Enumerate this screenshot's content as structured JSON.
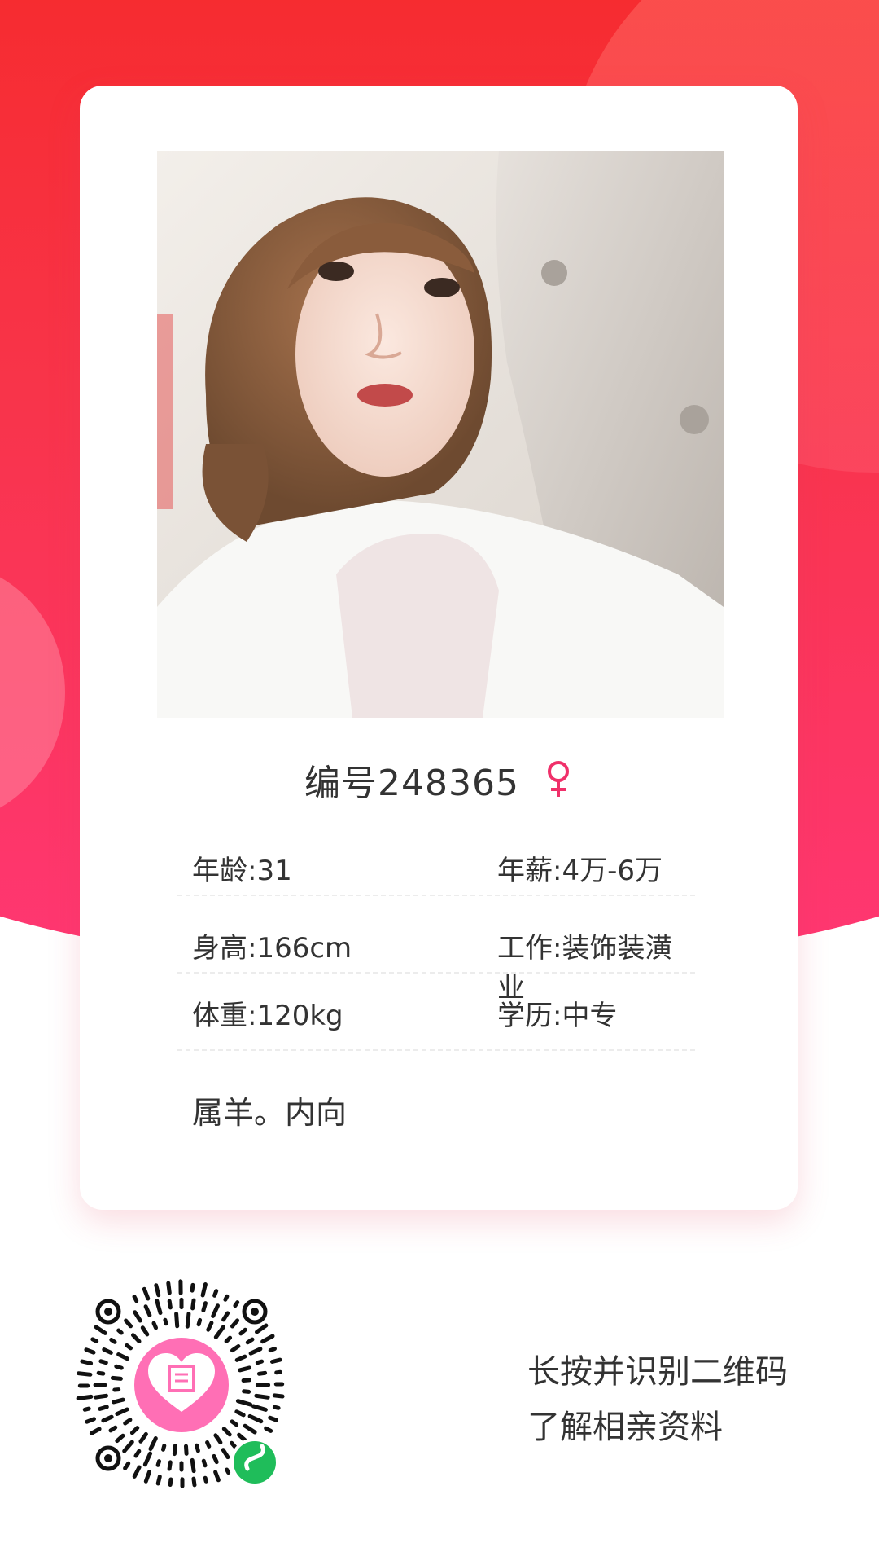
{
  "profile": {
    "title": "编号248365",
    "gender_icon": "female-symbol-icon",
    "gender_color": "#f0306a",
    "fields": [
      {
        "left": "年龄:31",
        "right": "年薪:4万-6万"
      },
      {
        "left": "身高:166cm",
        "right": "工作:装饰装潢业"
      },
      {
        "left": "体重:120kg",
        "right": "学历:中专"
      }
    ],
    "description": "属羊。内向"
  },
  "footer": {
    "qr_icon": "mini-program-qr-code",
    "hint_line1": "长按并识别二维码",
    "hint_line2": "了解相亲资料"
  },
  "colors": {
    "brand_red": "#f62a2b",
    "brand_pink": "#ff3773",
    "mini_program_green": "#1fbd5a",
    "logo_pink": "#ff6fb5"
  }
}
